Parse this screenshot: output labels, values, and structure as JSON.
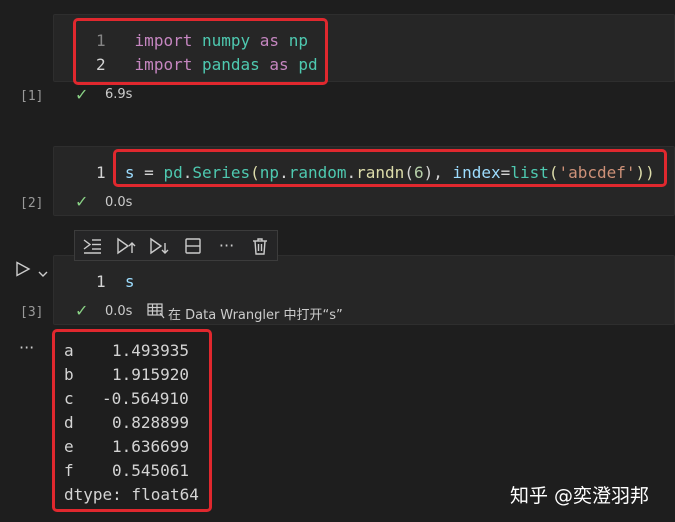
{
  "cells": [
    {
      "exec_count": "[1]",
      "lines": [
        {
          "number": "1",
          "tokens": [
            "import",
            "numpy",
            "as",
            "np"
          ]
        },
        {
          "number": "2",
          "tokens": [
            "import",
            "pandas",
            "as",
            "pd"
          ]
        }
      ],
      "time": "6.9s"
    },
    {
      "exec_count": "[2]",
      "lines": [
        {
          "number": "1",
          "tokens": [
            "s",
            " = ",
            "pd",
            ".",
            "Series",
            "(",
            "np",
            ".",
            "random",
            ".",
            "randn",
            "(",
            "6",
            "), ",
            "index",
            "=",
            "list",
            "(",
            "'abcdef'",
            "))"
          ]
        }
      ],
      "time": "0.0s"
    },
    {
      "exec_count": "[3]",
      "lines": [
        {
          "number": "1",
          "tokens": [
            "s"
          ]
        }
      ],
      "time": "0.0s",
      "data_wrangler_label": "在 Data Wrangler 中打开“s”"
    }
  ],
  "output": {
    "more_label": "···",
    "rows": [
      {
        "index": "a",
        "value": "1.493935"
      },
      {
        "index": "b",
        "value": "1.915920"
      },
      {
        "index": "c",
        "value": "-0.564910"
      },
      {
        "index": "d",
        "value": "0.828899"
      },
      {
        "index": "e",
        "value": "1.636699"
      },
      {
        "index": "f",
        "value": "0.545061"
      }
    ],
    "dtype": "dtype: float64"
  },
  "toolbar": {
    "icons": [
      "execute-above-icon",
      "run-above-icon",
      "run-below-icon",
      "split-cell-icon",
      "more-icon",
      "delete-icon"
    ],
    "more_label": "···"
  },
  "run_icon": "play-icon",
  "watermark": "知乎 @奕澄羽邦",
  "colors": {
    "highlight_border": "#e0282e",
    "success_check": "#89d185",
    "keyword": "#c586c0",
    "module": "#4ec9b0",
    "function": "#dcdcaa",
    "string": "#ce9178",
    "number": "#b5cea8",
    "variable": "#9cdcfe"
  }
}
